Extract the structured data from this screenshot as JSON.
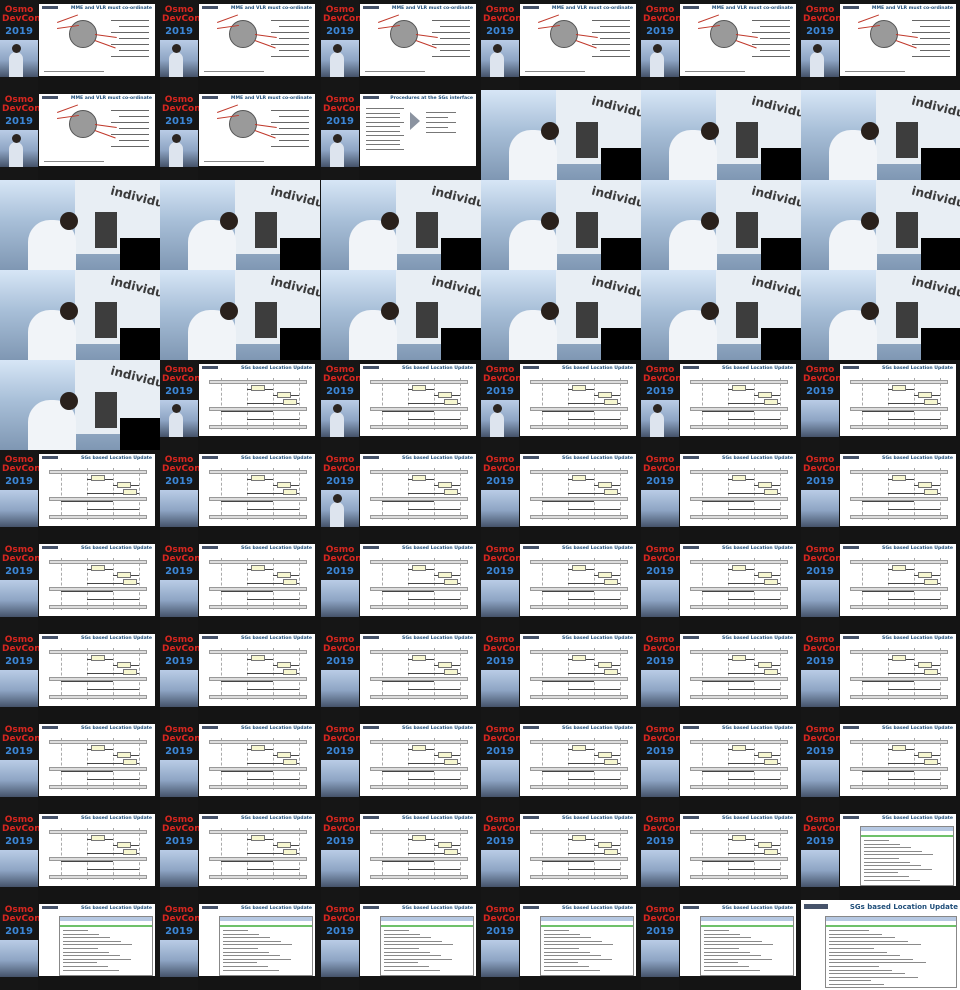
{
  "logo": {
    "line1": "Osmo",
    "line2": "DevCon",
    "year": "2019"
  },
  "slides": {
    "mme": "MME and VLR must co-ordinate",
    "proc": "Procedures at the SGs interface",
    "sgs": "SGs based Location Update",
    "video_word": "individu"
  },
  "layout": [
    "mme",
    "mme",
    "mme",
    "mme",
    "mme",
    "mme",
    "mme",
    "mme",
    "proc",
    "video",
    "video",
    "video",
    "video",
    "video",
    "video",
    "video",
    "video",
    "video",
    "video",
    "video",
    "video",
    "video",
    "video",
    "video",
    "video",
    "sgs",
    "sgs",
    "sgs",
    "sgs",
    "sgs",
    "sgs",
    "sgs",
    "sgs",
    "sgs",
    "sgs",
    "sgs",
    "sgs",
    "sgs",
    "sgs",
    "sgs",
    "sgs",
    "sgs",
    "sgs",
    "sgs",
    "sgs",
    "sgs",
    "sgs",
    "sgs",
    "sgs",
    "sgs",
    "sgs",
    "sgs",
    "sgs",
    "sgs",
    "sgs",
    "sgs",
    "sgs",
    "sgs",
    "sgs",
    "ws",
    "ws",
    "ws",
    "ws",
    "ws",
    "ws",
    "big"
  ],
  "empty_cam": [
    29,
    30,
    31,
    33,
    34,
    35,
    36,
    37,
    38,
    39,
    40,
    41,
    42,
    43,
    44,
    45,
    46,
    47,
    48,
    49,
    50,
    51,
    52,
    53,
    54,
    55,
    56,
    57,
    58,
    59,
    60,
    61,
    62,
    63,
    64
  ]
}
